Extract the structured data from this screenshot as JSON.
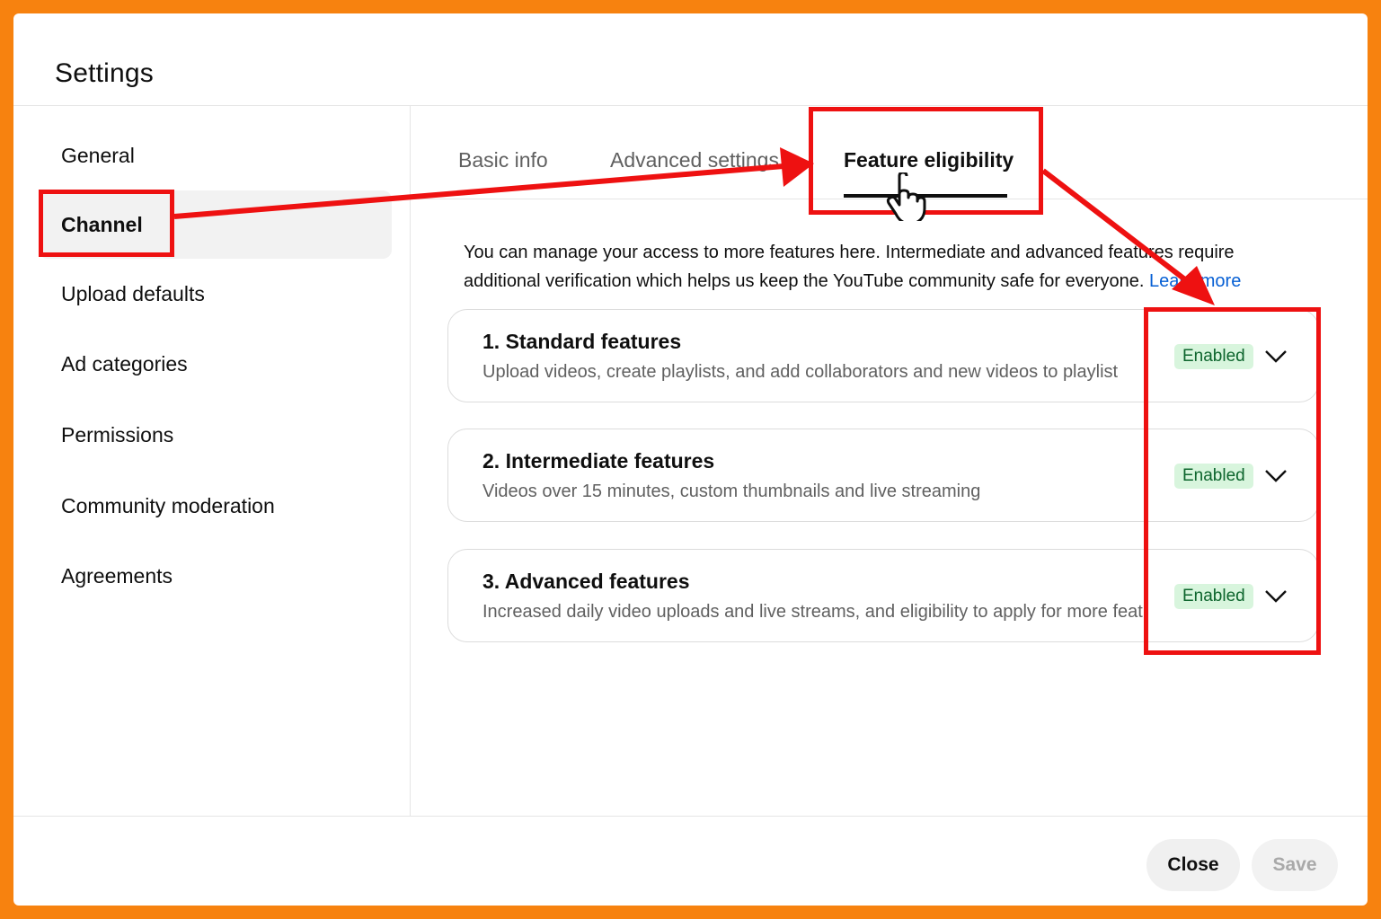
{
  "dialog": {
    "title": "Settings"
  },
  "sidebar": {
    "items": [
      {
        "label": "General"
      },
      {
        "label": "Channel",
        "active": true
      },
      {
        "label": "Upload defaults"
      },
      {
        "label": "Ad categories"
      },
      {
        "label": "Permissions"
      },
      {
        "label": "Community moderation"
      },
      {
        "label": "Agreements"
      }
    ]
  },
  "tabs": [
    {
      "label": "Basic info"
    },
    {
      "label": "Advanced settings"
    },
    {
      "label": "Feature eligibility",
      "active": true
    }
  ],
  "intro": {
    "text": "You can manage your access to more features here. Intermediate and advanced features require additional verification which helps us keep the YouTube community safe for everyone.",
    "link": "Learn more"
  },
  "features": [
    {
      "title": "1. Standard features",
      "description": "Upload videos, create playlists, and add collaborators and new videos to playlist",
      "status": "Enabled"
    },
    {
      "title": "2. Intermediate features",
      "description": "Videos over 15 minutes, custom thumbnails and live streaming",
      "status": "Enabled"
    },
    {
      "title": "3. Advanced features",
      "description": "Increased daily video uploads and live streams, and eligibility to apply for more features",
      "status": "Enabled"
    }
  ],
  "footer": {
    "close_label": "Close",
    "save_label": "Save"
  },
  "colors": {
    "frame": "#f7820f",
    "annotation": "#ee1111",
    "enabled_bg": "#d8f5dd",
    "enabled_text": "#0d652d",
    "link": "#065fd4"
  },
  "icons": {
    "expand": "chevron-down-icon",
    "cursor": "hand-pointer-icon"
  }
}
